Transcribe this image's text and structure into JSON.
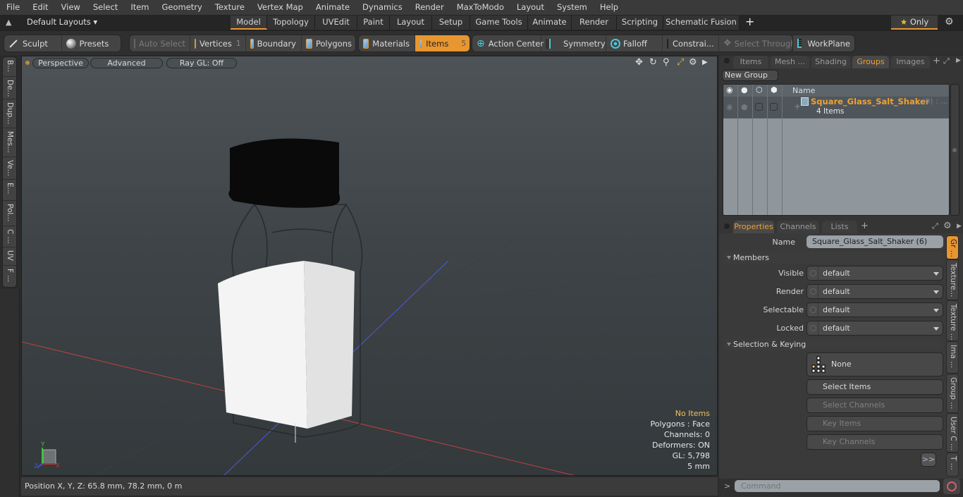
{
  "menu": [
    "File",
    "Edit",
    "View",
    "Select",
    "Item",
    "Geometry",
    "Texture",
    "Vertex Map",
    "Animate",
    "Dynamics",
    "Render",
    "MaxToModo",
    "Layout",
    "System",
    "Help"
  ],
  "layout_bar": {
    "layouts_label": "Default Layouts",
    "tabs": [
      "Model",
      "Topology",
      "UVEdit",
      "Paint",
      "Layout",
      "Setup",
      "Game Tools",
      "Animate",
      "Render",
      "Scripting",
      "Schematic Fusion"
    ],
    "active_tab": "Model",
    "add_label": "+",
    "only_label": "Only"
  },
  "toolbar": {
    "sculpt": "Sculpt",
    "presets": "Presets",
    "auto_select": "Auto Select",
    "vertices": "Vertices",
    "vertices_count": "1",
    "boundary": "Boundary",
    "polygons": "Polygons",
    "materials": "Materials",
    "items": "Items",
    "items_count": "5",
    "action_center": "Action Center",
    "symmetry": "Symmetry",
    "falloff": "Falloff",
    "constraints": "Constrai...",
    "select_through": "Select Through",
    "workplane": "WorkPlane"
  },
  "left_tabs": [
    "B...",
    "De...",
    "Dup...",
    "Mes...",
    "Ve...",
    "E...",
    "Pol...",
    "C ...",
    "UV",
    "F ..."
  ],
  "viewport": {
    "view_mode": "Perspective",
    "shading": "Advanced",
    "raygl": "Ray GL: Off",
    "hud": {
      "selection": "No Items",
      "polygons": "Polygons : Face",
      "channels": "Channels: 0",
      "deformers": "Deformers: ON",
      "gl": "GL: 5,798",
      "unit": "5 mm"
    },
    "axis_labels": {
      "x": "X",
      "y": "Y",
      "z": "Z"
    }
  },
  "status": {
    "position": "Position X, Y, Z:   65.8 mm, 78.2 mm, 0 m"
  },
  "scene_panel": {
    "tabs": [
      "Items",
      "Mesh ...",
      "Shading",
      "Groups",
      "Images"
    ],
    "active_tab": "Groups",
    "new_group": "New Group",
    "col_name": "Name",
    "group": {
      "name": "Square_Glass_Salt_Shaker",
      "suffix": "(6) : ...",
      "sub": "4 Items"
    }
  },
  "props_panel": {
    "tabs": [
      "Properties",
      "Channels",
      "Lists"
    ],
    "active_tab": "Properties",
    "name_label": "Name",
    "name_value": "Square_Glass_Salt_Shaker (6)",
    "members_section": "Members",
    "fields": [
      {
        "label": "Visible",
        "value": "default"
      },
      {
        "label": "Render",
        "value": "default"
      },
      {
        "label": "Selectable",
        "value": "default"
      },
      {
        "label": "Locked",
        "value": "default"
      }
    ],
    "selkey_section": "Selection & Keying",
    "none_label": "None",
    "select_items": "Select Items",
    "select_channels": "Select Channels",
    "key_items": "Key Items",
    "key_channels": "Key Channels",
    "more": ">>",
    "side_tabs": [
      "Gr ...",
      "Texture...",
      "Texture ...",
      "Ima ...",
      "Group ...",
      "User C ...",
      "T ..."
    ]
  },
  "command": {
    "prompt": ">",
    "placeholder": "Command"
  }
}
